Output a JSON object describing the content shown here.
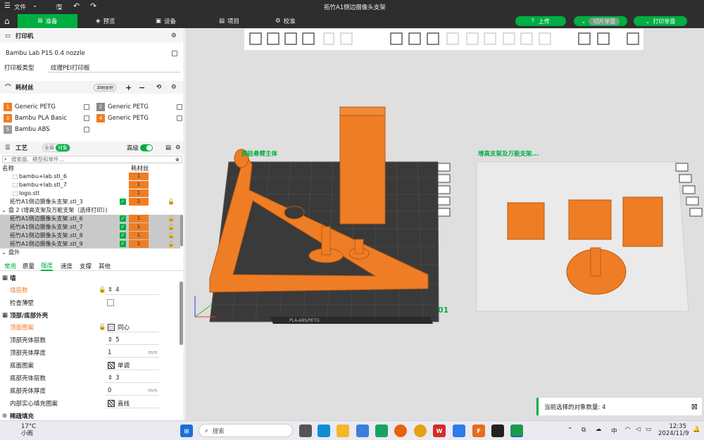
{
  "titlebar": {
    "file_menu": "文件",
    "title": "拓竹A1侧边摄像头支架"
  },
  "navbar": {
    "tabs": [
      {
        "label": "准备",
        "active": true
      },
      {
        "label": "预览"
      },
      {
        "label": "设备"
      },
      {
        "label": "项目"
      },
      {
        "label": "校准"
      }
    ],
    "upload": "上传",
    "slice": "切片单盘",
    "print": "打印单盘"
  },
  "printer": {
    "section": "打印机",
    "name": "Bambu Lab P1S 0.4 nozzle",
    "plate_label": "打印板类型",
    "plate_value": "纹理PEI打印板"
  },
  "filament": {
    "section": "耗材丝",
    "flush_btn": "冲刷体积",
    "items": [
      {
        "num": "1",
        "name": "Generic PETG",
        "color": "#ef7d25"
      },
      {
        "num": "2",
        "name": "Generic PETG",
        "color": "#8a8a8a"
      },
      {
        "num": "3",
        "name": "Bambu PLA Basic",
        "color": "#ef7d25"
      },
      {
        "num": "4",
        "name": "Generic PETG",
        "color": "#ef7d25"
      },
      {
        "num": "5",
        "name": "Bambu ABS",
        "color": "#9a9a9a"
      }
    ]
  },
  "process": {
    "section": "工艺",
    "toggle_global": "全局",
    "toggle_object": "对象",
    "advanced": "高级",
    "search_placeholder": "搜索盘、模型和零件..."
  },
  "objects": {
    "col_name": "名称",
    "col_filament": "耗材丝",
    "rows": [
      {
        "name": "bambu+lab.stl_6",
        "fil": "1",
        "sel": false,
        "indent": true
      },
      {
        "name": "bambu+lab.stl_7",
        "fil": "1",
        "sel": false,
        "indent": true
      },
      {
        "name": "logo.stl",
        "fil": "1",
        "sel": false,
        "indent": true
      },
      {
        "name": "拓竹A1侧边摄像头支架.stl_3",
        "fil": "1",
        "sel": false,
        "indent": false,
        "chk": true,
        "lock": true
      }
    ],
    "plate2": "盘 2 (增高支架及万能支架（选择打印）)",
    "rows2": [
      {
        "name": "拓竹A1侧边摄像头支架.stl_6",
        "fil": "1"
      },
      {
        "name": "拓竹A1侧边摄像头支架.stl_7",
        "fil": "1"
      },
      {
        "name": "拓竹A1侧边摄像头支架.stl_8",
        "fil": "1"
      },
      {
        "name": "拓竹A1侧边摄像头支架.stl_9",
        "fil": "1"
      }
    ],
    "plate_out": "盘外"
  },
  "tabs": [
    "常用",
    "质量",
    "强度",
    "速度",
    "支撑",
    "其他"
  ],
  "params": {
    "wall_section": "墙",
    "wall_loops": {
      "label": "墙层数",
      "value": "4"
    },
    "detect_thin": {
      "label": "检查薄壁"
    },
    "top_bottom_section": "顶部/底部外壳",
    "top_pattern": {
      "label": "顶面图案",
      "value": "同心"
    },
    "top_layers": {
      "label": "顶部壳体层数",
      "value": "5"
    },
    "top_thickness": {
      "label": "顶部壳体厚度",
      "value": "1",
      "unit": "mm"
    },
    "bottom_pattern": {
      "label": "底面图案",
      "value": "单调"
    },
    "bottom_layers": {
      "label": "底部壳体层数",
      "value": "3"
    },
    "bottom_thickness": {
      "label": "底部壳体厚度",
      "value": "0",
      "unit": "mm"
    },
    "internal_solid": {
      "label": "内部实心填充图案",
      "value": "直线"
    },
    "sparse_section": "稀疏填充"
  },
  "viewport": {
    "plate1_label": "侧挂悬臂主体",
    "plate2_label": "增高支架及万能支架...",
    "plate1_num": "01",
    "plate_text": "PLA-ABS/PETG",
    "notification": "当前选择的对象数量: 4"
  },
  "taskbar": {
    "weather_temp": "17°C",
    "weather_desc": "小雨",
    "search": "搜索",
    "time": "12:35",
    "date": "2024/11/9",
    "ime": "中"
  }
}
